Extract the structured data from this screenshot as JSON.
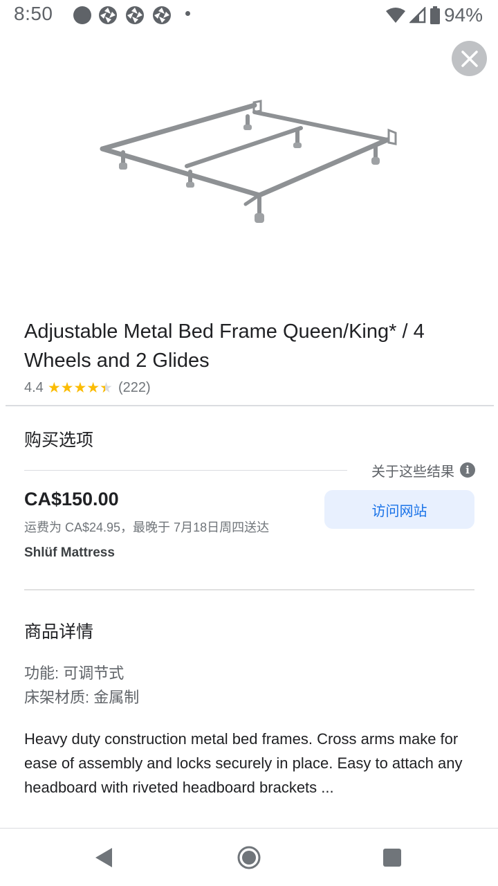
{
  "status_bar": {
    "time": "8:50",
    "battery": "94%"
  },
  "icons": {
    "close": "close-icon",
    "info": "info-icon",
    "back": "nav-back-icon",
    "home": "nav-home-icon",
    "recents": "nav-recents-icon"
  },
  "product": {
    "title": "Adjustable Metal Bed Frame Queen/King* / 4 Wheels and 2 Glides",
    "rating": "4.4",
    "rating_value": 4.4,
    "rating_max": 5,
    "review_count": "(222)"
  },
  "buying_options": {
    "heading": "购买选项",
    "about_results": "关于这些结果",
    "info_glyph": "i",
    "price": "CA$150.00",
    "shipping": "运费为 CA$24.95，最晚于 7月18日周四送达",
    "seller": "Shlüf Mattress",
    "visit_button": "访问网站"
  },
  "details": {
    "heading": "商品详情",
    "specs": [
      "功能: 可调节式",
      "床架材质: 金属制"
    ],
    "description": "Heavy duty construction metal bed frames. Cross arms make for ease of assembly and locks securely in place. Easy to attach any headboard with riveted headboard brackets ..."
  },
  "colors": {
    "link_blue": "#1a73e8",
    "button_bg": "#e8f0fe",
    "star": "#fbbc04"
  }
}
